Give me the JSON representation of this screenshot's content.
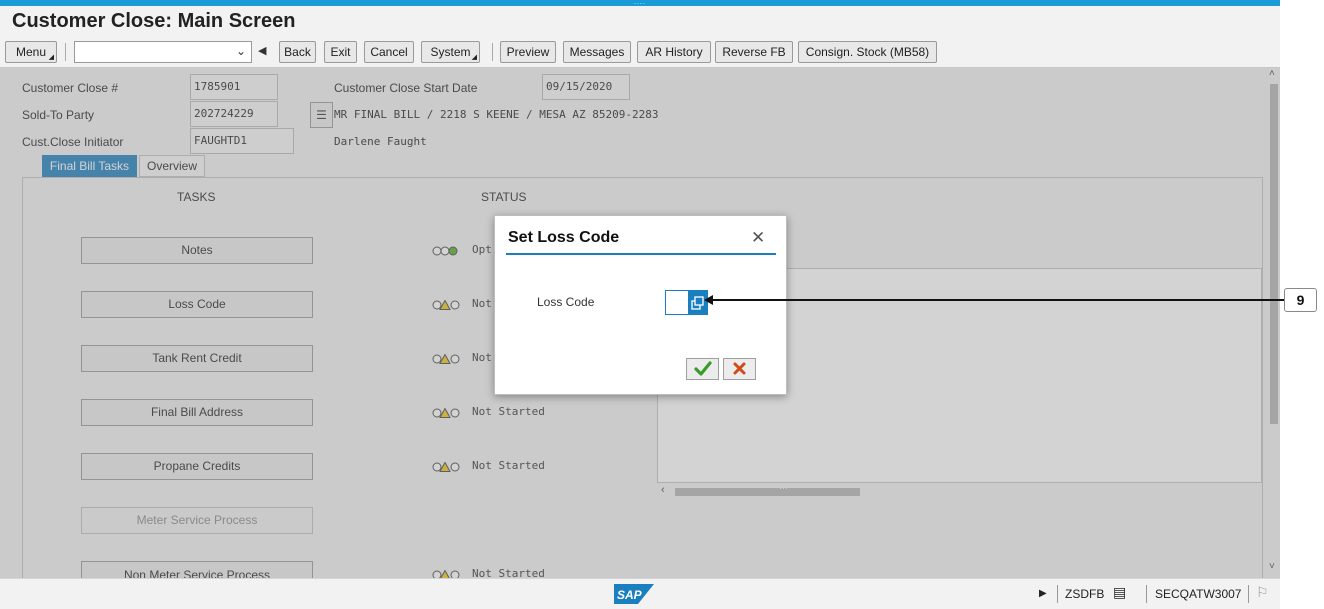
{
  "window": {
    "title": "Customer Close: Main Screen",
    "grip": "...."
  },
  "toolbar": {
    "menu_label": "Menu",
    "command_field_value": "",
    "back_label": "Back",
    "exit_label": "Exit",
    "cancel_label": "Cancel",
    "system_label": "System",
    "preview_label": "Preview",
    "messages_label": "Messages",
    "ar_history_label": "AR History",
    "reverse_fb_label": "Reverse FB",
    "consign_stock_label": "Consign. Stock (MB58)"
  },
  "header": {
    "customer_close_label": "Customer Close #",
    "customer_close_value": "1785901",
    "start_date_label": "Customer Close Start Date",
    "start_date_value": "09/15/2020",
    "sold_to_label": "Sold-To Party",
    "sold_to_value": "202724229",
    "sold_to_address": "MR FINAL BILL / 2218 S KEENE / MESA AZ 85209-2283",
    "initiator_label": "Cust.Close Initiator",
    "initiator_value": "FAUGHTD1",
    "initiator_name": "Darlene Faught"
  },
  "tabs": [
    {
      "label": "Final Bill Tasks",
      "active": true
    },
    {
      "label": "Overview",
      "active": false
    }
  ],
  "tasks_panel": {
    "tasks_header": "TASKS",
    "status_header": "STATUS",
    "tasks": [
      {
        "label": "Notes",
        "status": "Opt",
        "lights": "green",
        "disabled": false
      },
      {
        "label": "Loss Code",
        "status": "Not",
        "lights": "yellow",
        "disabled": false
      },
      {
        "label": "Tank Rent Credit",
        "status": "Not",
        "lights": "yellow",
        "disabled": false
      },
      {
        "label": "Final Bill Address",
        "status": "Not Started",
        "lights": "yellow",
        "disabled": false
      },
      {
        "label": "Propane Credits",
        "status": "Not Started",
        "lights": "yellow",
        "disabled": false
      },
      {
        "label": "Meter Service Process",
        "status": "",
        "lights": "none",
        "disabled": true
      },
      {
        "label": "Non Meter Service Process",
        "status": "Not Started",
        "lights": "yellow",
        "disabled": false
      }
    ]
  },
  "dialog": {
    "title": "Set Loss Code",
    "field_label": "Loss Code",
    "field_value": ""
  },
  "callout": {
    "number": "9"
  },
  "statusbar": {
    "logo_text": "SAP",
    "transaction": "ZSDFB",
    "system": "SECQATW3007"
  },
  "colors": {
    "accent": "#1a7fbf",
    "top_bar": "#1a9ad6",
    "ok_green": "#3a9a2a",
    "cancel_red": "#d04a1a",
    "light_yellow": "#f2c811",
    "light_green": "#4caf1f"
  }
}
